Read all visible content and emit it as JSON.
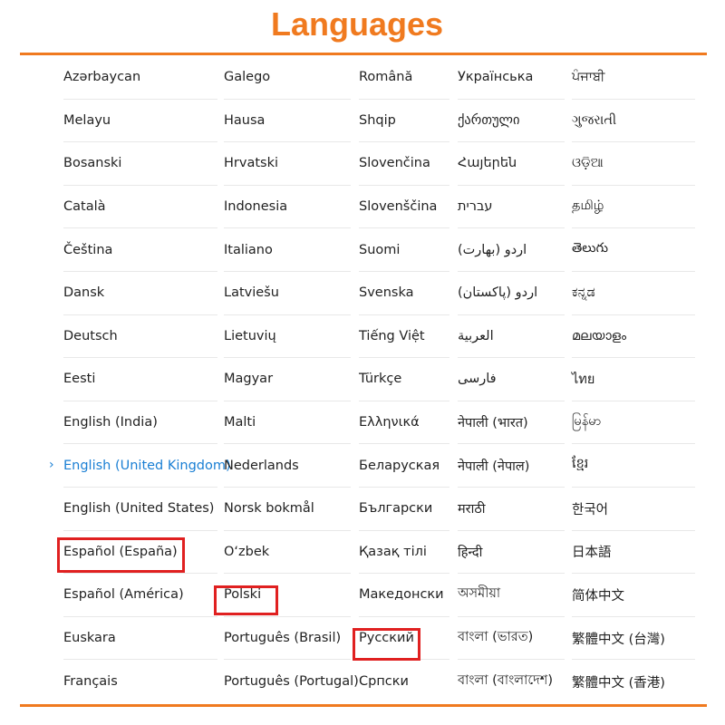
{
  "title": "Languages",
  "selected_language": "English (United Kingdom)",
  "highlighted_languages": [
    "Español (España)",
    "Polski",
    "Русский"
  ],
  "columns": [
    [
      "Azərbaycan",
      "Melayu",
      "Bosanski",
      "Català",
      "Čeština",
      "Dansk",
      "Deutsch",
      "Eesti",
      "English (India)",
      "English (United Kingdom)",
      "English (United States)",
      "Español (España)",
      "Español (América)",
      "Euskara",
      "Français"
    ],
    [
      "Galego",
      "Hausa",
      "Hrvatski",
      "Indonesia",
      "Italiano",
      "Latviešu",
      "Lietuvių",
      "Magyar",
      "Malti",
      "Nederlands",
      "Norsk bokmål",
      "O‘zbek",
      "Polski",
      "Português (Brasil)",
      "Português (Portugal)"
    ],
    [
      "Română",
      "Shqip",
      "Slovenčina",
      "Slovenščina",
      "Suomi",
      "Svenska",
      "Tiếng Việt",
      "Türkçe",
      "Ελληνικά",
      "Беларуская",
      "Български",
      "Қазақ тілі",
      "Македонски",
      "Русский",
      "Српски"
    ],
    [
      "Українська",
      "ქართული",
      "Հայերեն",
      "עברית",
      "اردو (بھارت)",
      "اردو (پاکستان)",
      "العربية",
      "فارسی",
      "नेपाली (भारत)",
      "नेपाली (नेपाल)",
      "मराठी",
      "हिन्दी",
      "অসমীয়া",
      "বাংলা (ভারত)",
      "বাংলা (বাংলাদেশ)"
    ],
    [
      "ਪੰਜਾਬੀ",
      "ગુજરાતી",
      "ଓଡ଼ିଆ",
      "தமிழ்",
      "తెలుగు",
      "ಕನ್ನಡ",
      "മലയാളം",
      "ไทย",
      "မြန်မာ",
      "ខ្មែរ",
      "한국어",
      "日本語",
      "简体中文",
      "繁體中文 (台灣)",
      "繁體中文 (香港)"
    ]
  ]
}
